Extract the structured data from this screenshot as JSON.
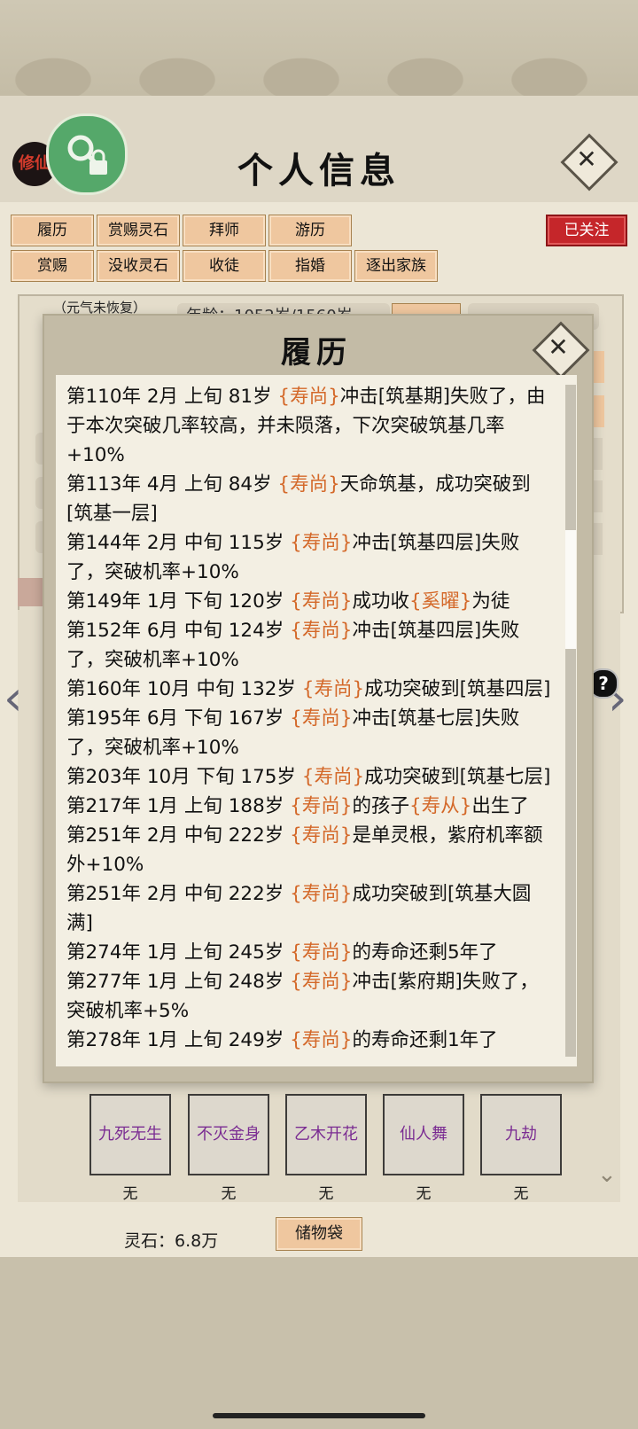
{
  "header": {
    "title": "个人信息",
    "logo_text": "修仙"
  },
  "tabs": {
    "row1": [
      "履历",
      "赏赐灵石",
      "拜师",
      "游历"
    ],
    "row2": [
      "赏赐",
      "没收灵石",
      "收徒",
      "指婚",
      "逐出家族"
    ]
  },
  "follow_badge": "已关注",
  "behind": {
    "status_note": "（元气未恢复）",
    "age_partial": "年龄：1052岁/1560岁"
  },
  "modal": {
    "title": "履历",
    "entries": [
      {
        "pre": "第110年 2月 上旬 81岁 ",
        "name": "{寿尚}",
        "mid": "冲击[筑基期]失败了，由于本次突破几率较高，并未陨落，下次突破筑基几率+10%",
        "name2": "",
        "post": ""
      },
      {
        "pre": "第113年 4月 上旬 84岁 ",
        "name": "{寿尚}",
        "mid": "天命筑基，成功突破到[筑基一层]",
        "name2": "",
        "post": ""
      },
      {
        "pre": "第144年 2月 中旬  115岁  ",
        "name": "{寿尚}",
        "mid": "冲击[筑基四层]失败了，突破机率+10%",
        "name2": "",
        "post": ""
      },
      {
        "pre": "第149年 1月 下旬  120岁  ",
        "name": "{寿尚}",
        "mid": "成功收",
        "name2": "{奚曜}",
        "post": "为徒"
      },
      {
        "pre": "第152年 6月 中旬  124岁  ",
        "name": "{寿尚}",
        "mid": "冲击[筑基四层]失败了，突破机率+10%",
        "name2": "",
        "post": ""
      },
      {
        "pre": "第160年 10月 中旬 132岁 ",
        "name": "{寿尚}",
        "mid": "成功突破到[筑基四层]",
        "name2": "",
        "post": ""
      },
      {
        "pre": "第195年 6月 下旬  167岁  ",
        "name": "{寿尚}",
        "mid": "冲击[筑基七层]失败了，突破机率+10%",
        "name2": "",
        "post": ""
      },
      {
        "pre": "第203年 10月 下旬 175岁 ",
        "name": "{寿尚}",
        "mid": "成功突破到[筑基七层]",
        "name2": "",
        "post": ""
      },
      {
        "pre": "第217年 1月 上旬  188岁  ",
        "name": "{寿尚}",
        "mid": "的孩子",
        "name2": "{寿从}",
        "post": "出生了"
      },
      {
        "pre": "第251年 2月 中旬 222岁 ",
        "name": "{寿尚}",
        "mid": "是单灵根，紫府机率额外+10%",
        "name2": "",
        "post": ""
      },
      {
        "pre": "第251年 2月 中旬  222岁  ",
        "name": "{寿尚}",
        "mid": "成功突破到[筑基大圆满]",
        "name2": "",
        "post": ""
      },
      {
        "pre": "第274年 1月 上旬  245岁  ",
        "name": "{寿尚}",
        "mid": "的寿命还剩5年了",
        "name2": "",
        "post": ""
      },
      {
        "pre": "第277年 1月 上旬  248岁  ",
        "name": "{寿尚}",
        "mid": "冲击[紫府期]失败了，突破机率+5%",
        "name2": "",
        "post": ""
      },
      {
        "pre": "第278年 1月 上旬  249岁  ",
        "name": "{寿尚}",
        "mid": "的寿命还剩1年了",
        "name2": "",
        "post": ""
      }
    ]
  },
  "skills": [
    {
      "name": "九死无生",
      "status": "无"
    },
    {
      "name": "不灭金身",
      "status": "无"
    },
    {
      "name": "乙木开花",
      "status": "无"
    },
    {
      "name": "仙人舞",
      "status": "无"
    },
    {
      "name": "九劫",
      "status": "无"
    }
  ],
  "footer": {
    "stones": "灵石：6.8万",
    "bag": "储物袋"
  },
  "colors": {
    "name_highlight": "#d4692a",
    "skill_text": "#7a2c92",
    "follow_red": "#c5262a"
  }
}
